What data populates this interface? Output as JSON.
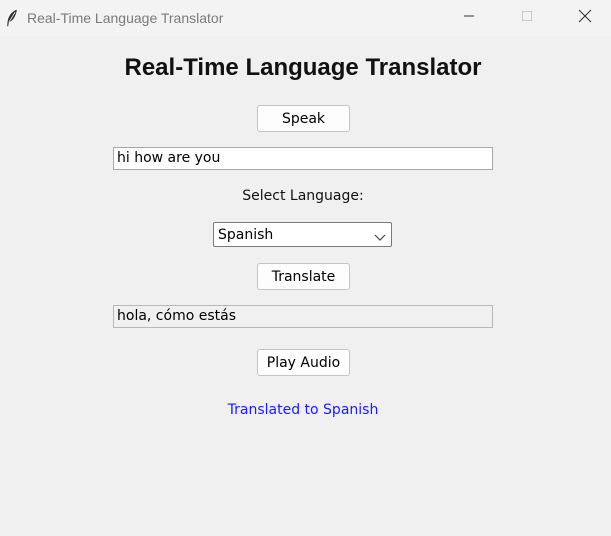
{
  "window": {
    "title": "Real-Time Language Translator",
    "app_icon": "feather-icon"
  },
  "controls": {
    "minimize_icon": "minimize-icon",
    "maximize_icon": "maximize-icon",
    "close_icon": "close-icon"
  },
  "main": {
    "heading": "Real-Time Language Translator",
    "speak_button": "Speak",
    "input_text": "hi how are you",
    "select_label": "Select Language:",
    "language_selected": "Spanish",
    "translate_button": "Translate",
    "output_text": "hola, cómo estás",
    "play_button": "Play Audio",
    "status": "Translated to Spanish"
  },
  "colors": {
    "background": "#f0f0f0",
    "status_text": "#1a1aff"
  }
}
